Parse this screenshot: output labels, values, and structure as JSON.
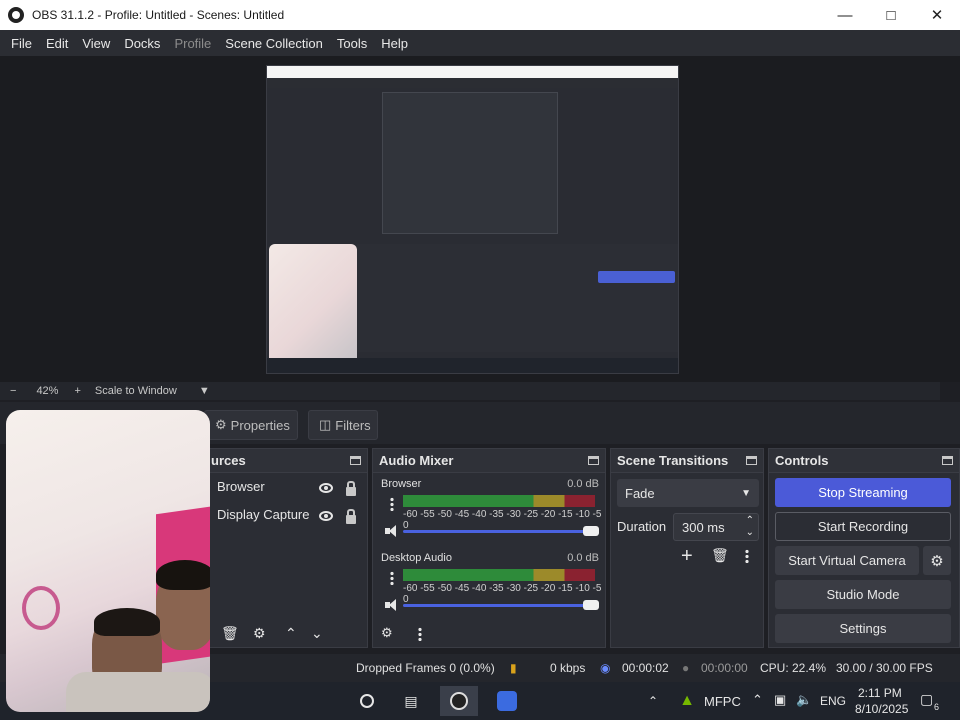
{
  "window": {
    "title": "OBS 31.1.2 - Profile: Untitled - Scenes: Untitled"
  },
  "menu": [
    "File",
    "Edit",
    "View",
    "Docks",
    "Profile",
    "Scene Collection",
    "Tools",
    "Help"
  ],
  "preview_bar": {
    "minus": "−",
    "zoom": "42%",
    "plus": "+",
    "scale_mode": "Scale to Window"
  },
  "source_toolbar": {
    "properties": "Properties",
    "filters": "Filters"
  },
  "sources": {
    "title": "urces",
    "items": [
      {
        "label": "Browser"
      },
      {
        "label": "Display Capture"
      }
    ]
  },
  "mixer": {
    "title": "Audio Mixer",
    "tracks": [
      {
        "name": "Browser",
        "db": "0.0 dB",
        "volume": 1.0
      },
      {
        "name": "Desktop Audio",
        "db": "0.0 dB",
        "volume": 1.0
      }
    ],
    "ticks": "-60 -55 -50 -45 -40 -35 -30 -25 -20 -15 -10 -5 0"
  },
  "transitions": {
    "title": "Scene Transitions",
    "selected": "Fade",
    "duration_label": "Duration",
    "duration_value": "300 ms"
  },
  "controls": {
    "title": "Controls",
    "stop_streaming": "Stop Streaming",
    "start_recording": "Start Recording",
    "start_virtual_camera": "Start Virtual Camera",
    "studio_mode": "Studio Mode",
    "settings": "Settings"
  },
  "status": {
    "dropped_frames": "Dropped Frames 0 (0.0%)",
    "kbps": "0 kbps",
    "stream_time": "00:00:02",
    "record_time": "00:00:00",
    "cpu": "CPU: 22.4%",
    "fps": "30.00 / 30.00 FPS"
  },
  "taskbar": {
    "network": "MFPC",
    "language": "ENG",
    "time": "2:11 PM",
    "date": "8/10/2025",
    "notifications": "6"
  },
  "colors": {
    "accent": "#4b5ad8",
    "bg": "#1e1f24",
    "panel": "#2b2d34"
  }
}
